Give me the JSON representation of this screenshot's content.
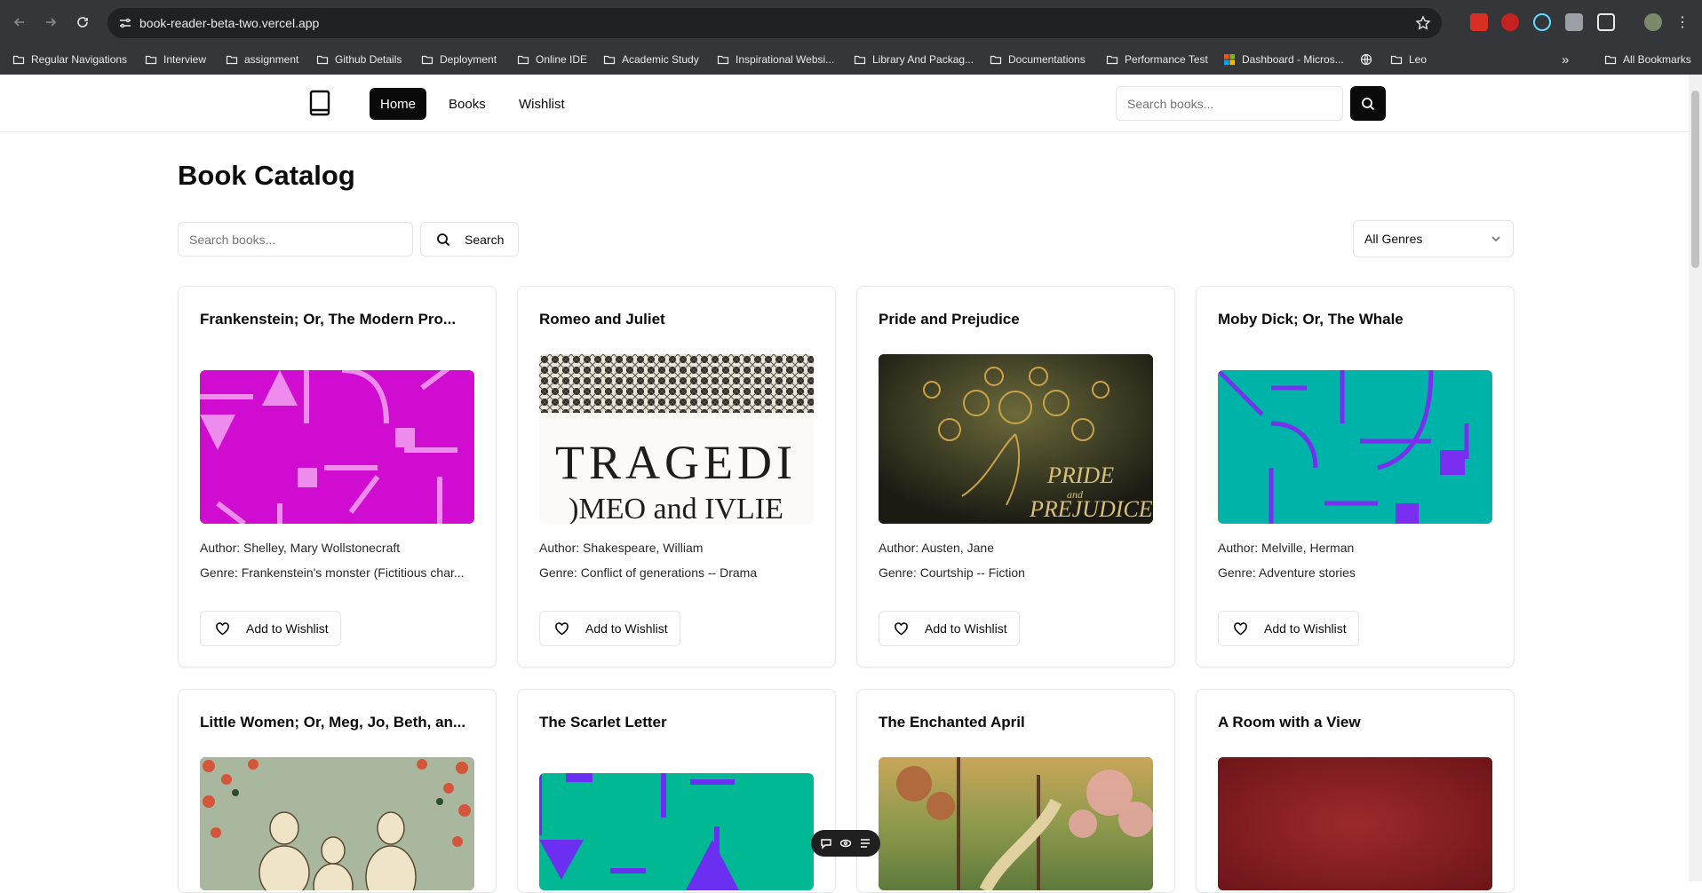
{
  "browser": {
    "url": "book-reader-beta-two.vercel.app",
    "bookmarks": [
      {
        "label": "Regular Navigations",
        "icon": "folder-icon"
      },
      {
        "label": "Interview",
        "icon": "folder-icon"
      },
      {
        "label": "assignment",
        "icon": "folder-icon"
      },
      {
        "label": "Github Details",
        "icon": "folder-icon"
      },
      {
        "label": "Deployment",
        "icon": "folder-icon"
      },
      {
        "label": "Online IDE",
        "icon": "folder-icon"
      },
      {
        "label": "Academic Study",
        "icon": "folder-icon"
      },
      {
        "label": "Inspirational Websi...",
        "icon": "folder-icon"
      },
      {
        "label": "Library And Packag...",
        "icon": "folder-icon"
      },
      {
        "label": "Documentations",
        "icon": "folder-icon"
      },
      {
        "label": "Performance Test",
        "icon": "folder-icon"
      },
      {
        "label": "Dashboard - Micros...",
        "icon": "microsoft-icon"
      },
      {
        "label": "Leo",
        "icon": "folder-icon"
      }
    ],
    "all_bookmarks": "All Bookmarks",
    "overflow": "»"
  },
  "header": {
    "nav": [
      "Home",
      "Books",
      "Wishlist"
    ],
    "active": "Home",
    "search_placeholder": "Search books..."
  },
  "catalog": {
    "title": "Book Catalog",
    "search_placeholder": "Search books...",
    "search_button": "Search",
    "genre_select": "All Genres"
  },
  "books": [
    {
      "title": "Frankenstein; Or, The Modern Pro...",
      "author": "Author: Shelley, Mary Wollstonecraft",
      "genre": "Genre: Frankenstein's monster (Fictitious char...",
      "wishlist": "Add to Wishlist",
      "cover": "magenta-pattern"
    },
    {
      "title": "Romeo and Juliet",
      "author": "Author: Shakespeare, William",
      "genre": "Genre: Conflict of generations -- Drama",
      "wishlist": "Add to Wishlist",
      "cover": "tragedie-print",
      "cover_text_1": "TRAGEDI",
      "cover_text_2": ")MEO and IVLIE"
    },
    {
      "title": "Pride and Prejudice",
      "author": "Author: Austen, Jane",
      "genre": "Genre: Courtship -- Fiction",
      "wishlist": "Add to Wishlist",
      "cover": "peacock",
      "cover_text_1": "PRIDE",
      "cover_text_2": "and",
      "cover_text_3": "PREJUDICE"
    },
    {
      "title": "Moby Dick; Or, The Whale",
      "author": "Author: Melville, Herman",
      "genre": "Genre: Adventure stories",
      "wishlist": "Add to Wishlist",
      "cover": "teal-pattern"
    },
    {
      "title": "Little Women; Or, Meg, Jo, Beth, an...",
      "cover": "floral-illustration"
    },
    {
      "title": "The Scarlet Letter",
      "cover": "green-purple-pattern"
    },
    {
      "title": "The Enchanted April",
      "cover": "garden-painting"
    },
    {
      "title": "A Room with a View",
      "cover": "red-cloth"
    }
  ],
  "colors": {
    "primary": "#0a0a0a",
    "border": "#e5e7eb",
    "chrome": "#35363a"
  }
}
